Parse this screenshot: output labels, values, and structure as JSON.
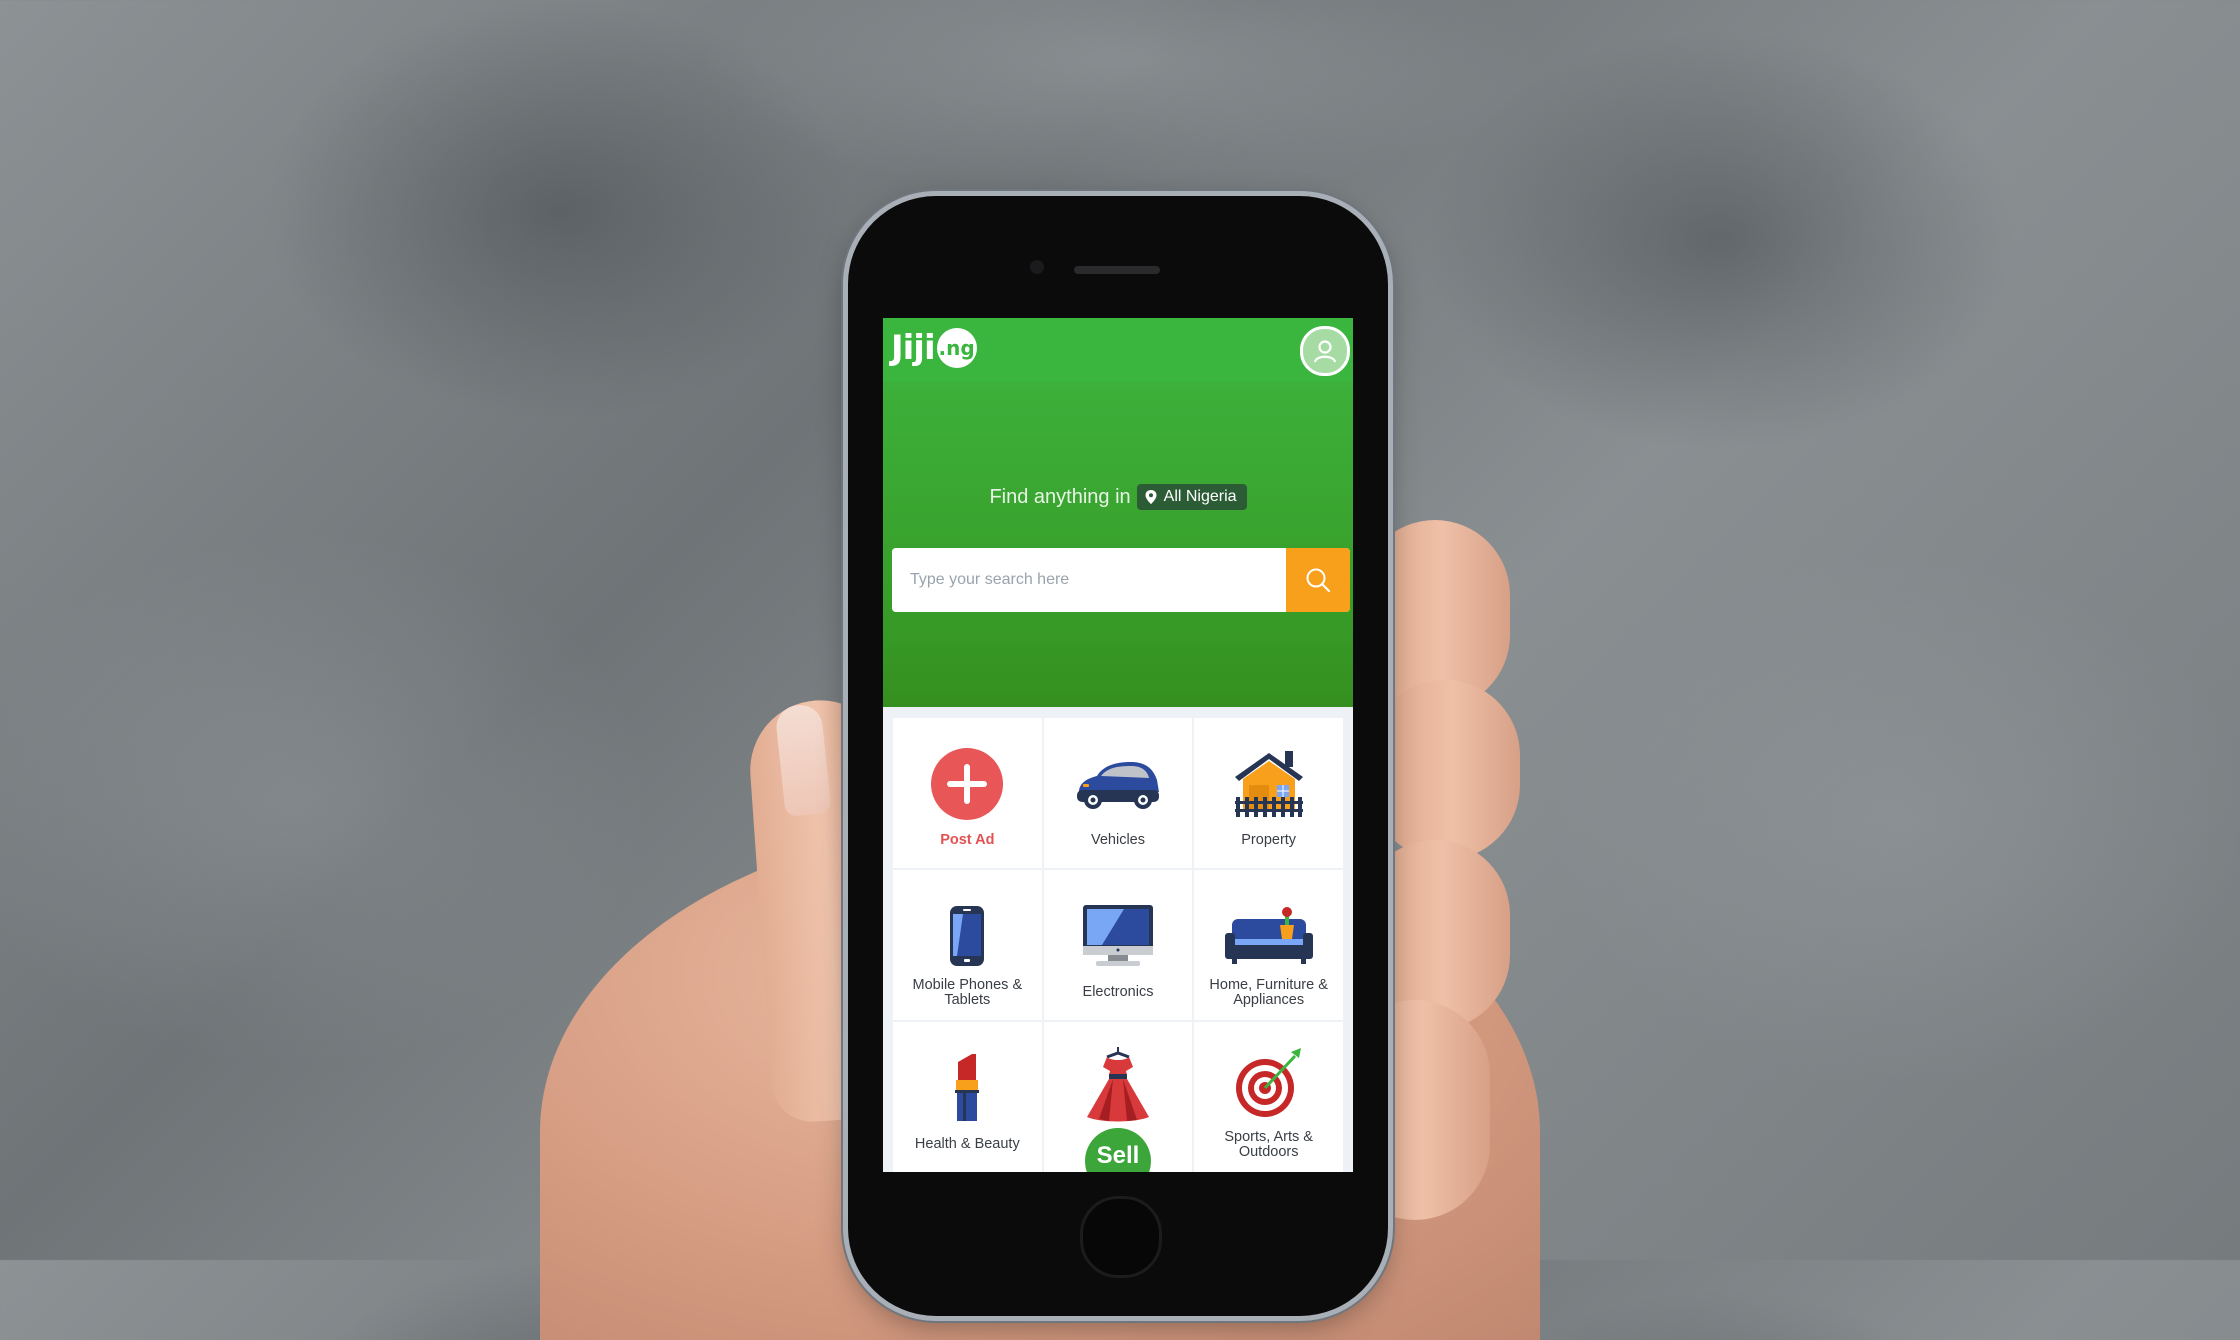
{
  "header": {
    "logo_text": "Jiji",
    "logo_suffix": ".ng",
    "account_icon": "user-icon"
  },
  "hero": {
    "find_text": "Find anything in",
    "location": "All Nigeria",
    "location_icon": "map-pin-icon",
    "search": {
      "placeholder": "Type your search here",
      "value": "",
      "button_icon": "search-icon"
    }
  },
  "categories": [
    {
      "label": "Post Ad",
      "icon": "plus-circle-icon"
    },
    {
      "label": "Vehicles",
      "icon": "car-icon"
    },
    {
      "label": "Property",
      "icon": "house-icon"
    },
    {
      "label": "Mobile Phones & Tablets",
      "icon": "phone-icon"
    },
    {
      "label": "Electronics",
      "icon": "monitor-icon"
    },
    {
      "label": "Home, Furniture & Appliances",
      "icon": "sofa-icon"
    },
    {
      "label": "Health & Beauty",
      "icon": "lipstick-icon"
    },
    {
      "label": "",
      "icon": "dress-icon"
    },
    {
      "label": "Sports, Arts & Outdoors",
      "icon": "target-icon"
    }
  ],
  "sell_button": {
    "label": "Sell"
  },
  "colors": {
    "brand_green": "#3ab53e",
    "search_button": "#f8a01b",
    "post_ad_red": "#e25252",
    "location_pill": "#2b5c36"
  }
}
